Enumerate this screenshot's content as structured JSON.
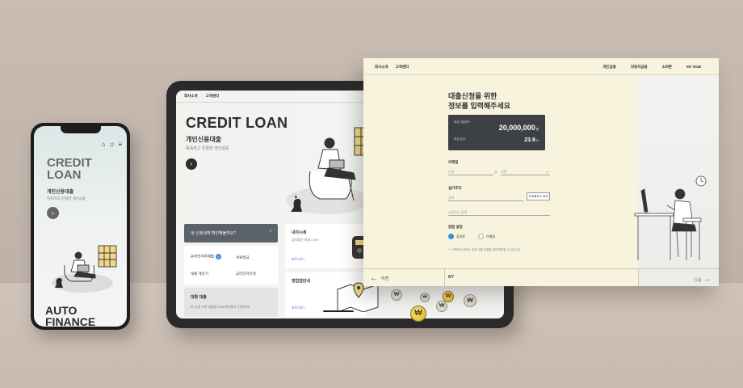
{
  "phone": {
    "title": "CREDIT LOAN",
    "subtitle": "개인신용대출",
    "description": "똑똑하고 친절한 개인금융",
    "footer_title": "AUTO FINANCE",
    "icons": [
      "home-icon",
      "bell-icon",
      "menu-icon"
    ]
  },
  "tablet": {
    "nav": [
      "회사소개",
      "고객센터"
    ],
    "title": "CREDIT LOAN",
    "subtitle": "개인신용대출",
    "description": "똑똑하고 친절한 개인금융",
    "dark_card": "내 신청내역 확인해볼까요?",
    "grid": {
      "item1": "온라인서류제출",
      "item1_badge": "2",
      "item2": "서류발급",
      "item3": "대출 계산기",
      "item4": "금리인하신청"
    },
    "gray_card": {
      "title": "대환 대출",
      "text": "타 금융 기관 대출을 DGB캐피탈로 간편하게"
    },
    "card_a": {
      "title": "내차시세",
      "text": "금리할인 최대 2.5%",
      "link": "바로가기"
    },
    "card_b": {
      "title": "영업점안내",
      "link": "바로가기"
    }
  },
  "panel": {
    "nav_left": [
      "회사소개",
      "고객센터"
    ],
    "nav_right": [
      "개인금융",
      "자동차금융",
      "소비툰",
      "MY DGB"
    ],
    "heading_line1": "대출신청을 위한",
    "heading_line2": "정보를 입력해주세요",
    "summary": {
      "limit_label": "예상 대출한도",
      "limit_value": "20,000,000",
      "limit_unit": "원",
      "rate_label": "예상 금리",
      "rate_value": "23.9",
      "rate_unit": "%"
    },
    "email": {
      "label": "이메일",
      "placeholder": "입력",
      "domain": "선택"
    },
    "address": {
      "label": "실거주지",
      "placeholder": "검색",
      "search_button": "도로명주소 검색",
      "detail_placeholder": "상세주소 입력"
    },
    "mail": {
      "label": "알림 설정",
      "option1": "휴대폰",
      "option2": "이메일"
    },
    "note": "※ 선택하신 정보는 추후 대출 진행을 위해 활용될 수 있습니다.",
    "footer": {
      "prev": "이전",
      "page": "6/7",
      "next": "다음"
    }
  },
  "colors": {
    "panel_bg": "#f7f3dc",
    "dark_card": "#3d4145",
    "accent_blue": "#3a8de0"
  }
}
